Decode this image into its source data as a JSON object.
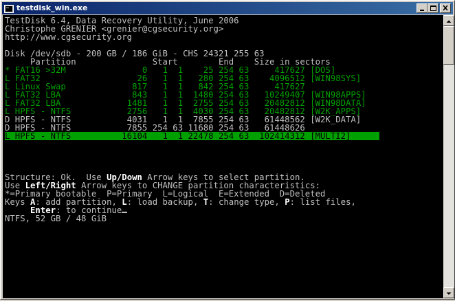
{
  "window": {
    "title": "testdisk_win.exe"
  },
  "console": {
    "header": [
      "TestDisk 6.4, Data Recovery Utility, June 2006",
      "Christophe GRENIER <grenier@cgsecurity.org>",
      "http://www.cgsecurity.org"
    ],
    "disk_line": "Disk /dev/sdb - 200 GB / 186 GiB - CHS 24321 255 63",
    "column_headers": "     Partition               Start        End    Size in sectors",
    "partitions": [
      {
        "text": "* FAT16 >32M               0   1  1    25 254 63     417627 [DOS]",
        "status": "found"
      },
      {
        "text": "L FAT32                   26   1  1   280 254 63    4096512 [WIN98SYS]",
        "status": "found"
      },
      {
        "text": "L Linux Swap             817   1  1   842 254 63     417627",
        "status": "found"
      },
      {
        "text": "L FAT32 LBA              843   1  1  1480 254 63   10249407 [WIN98APPS]",
        "status": "found"
      },
      {
        "text": "L FAT32 LBA             1481   1  1  2755 254 63   20482812 [WIN98DATA]",
        "status": "found"
      },
      {
        "text": "L HPFS - NTFS           2756   1  1  4030 254 63   20482812 [W2K_APPS]",
        "status": "found"
      },
      {
        "text": "D HPFS - NTFS           4031   1  1  7855 254 63   61448562 [W2K_DATA]",
        "status": "deleted"
      },
      {
        "text": "D HPFS - NTFS           7855 254 63 11680 254 63   61448626",
        "status": "deleted"
      },
      {
        "text": "L HPFS - NTFS          16104   1  1 22478 254 63  102414312 [MULTI2]",
        "status": "selected"
      }
    ],
    "help": {
      "l1_a": "Structure: Ok.  Use ",
      "l1_b": "Up/Down",
      "l1_c": " Arrow keys to select partition.",
      "l2_a": "Use ",
      "l2_b": "Left/Right",
      "l2_c": " Arrow keys to CHANGE partition characteristics:",
      "l3": "*=Primary bootable  P=Primary  L=Logical  E=Extended  D=Deleted",
      "l4_a": "Keys ",
      "l4_b": "A",
      "l4_c": ": add partition, ",
      "l4_d": "L",
      "l4_e": ": load backup, ",
      "l4_f": "T",
      "l4_g": ": change type, ",
      "l4_h": "P",
      "l4_i": ": list files,",
      "l5_a": "     ",
      "l5_b": "Enter",
      "l5_c": ": to continue"
    },
    "status_line": "NTFS, 52 GB / 48 GiB"
  },
  "colors": {
    "found": "#00a000",
    "deleted": "#c0c0c0",
    "selected_bg": "#00a000",
    "title_bar": "#0a246a"
  },
  "icons": {
    "app": "terminal-app-icon",
    "minimize": "minimize-icon",
    "maximize": "maximize-icon",
    "close": "close-icon",
    "scroll_up": "arrow-up-icon",
    "scroll_down": "arrow-down-icon"
  }
}
